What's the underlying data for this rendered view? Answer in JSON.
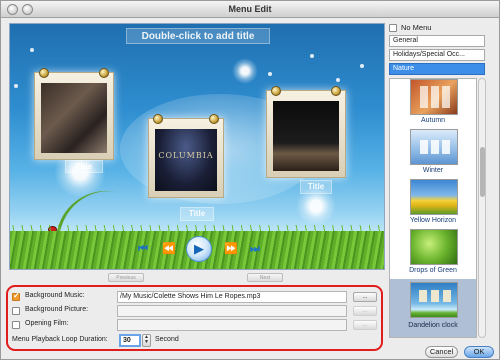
{
  "window": {
    "title": "Menu Edit"
  },
  "preview": {
    "add_title_hint": "Double-click to add title",
    "film_logo": "COLUMBIA",
    "frame_titles": [
      "Title",
      "Title",
      "Title"
    ],
    "pager": {
      "previous": "Previous",
      "next": "Next"
    },
    "controls": {
      "first": "⏮",
      "prev": "⏪",
      "play": "▶",
      "next": "⏩",
      "last": "⏭"
    }
  },
  "settings": {
    "background_music": {
      "label": "Background Music:",
      "checked": true,
      "value": "/My Music/Colette Shows Him Le Ropes.mp3",
      "browse": "..."
    },
    "background_picture": {
      "label": "Background Picture:",
      "checked": false,
      "value": "",
      "browse": "..."
    },
    "opening_film": {
      "label": "Opening Film:",
      "checked": false,
      "value": "",
      "browse": "..."
    },
    "loop_duration": {
      "label": "Menu Playback Loop Duration:",
      "value": "30",
      "unit": "Second"
    }
  },
  "themes": {
    "no_menu_label": "No Menu",
    "categories": [
      "General",
      "Holidays/Special Occ...",
      "Nature"
    ],
    "selected_category": "Nature",
    "items": [
      "Autumn",
      "Winter",
      "Yellow Horizon",
      "Drops of Green",
      "Dandelion clock"
    ],
    "selected_item": "Dandelion clock"
  },
  "buttons": {
    "cancel": "Cancel",
    "ok": "OK"
  }
}
